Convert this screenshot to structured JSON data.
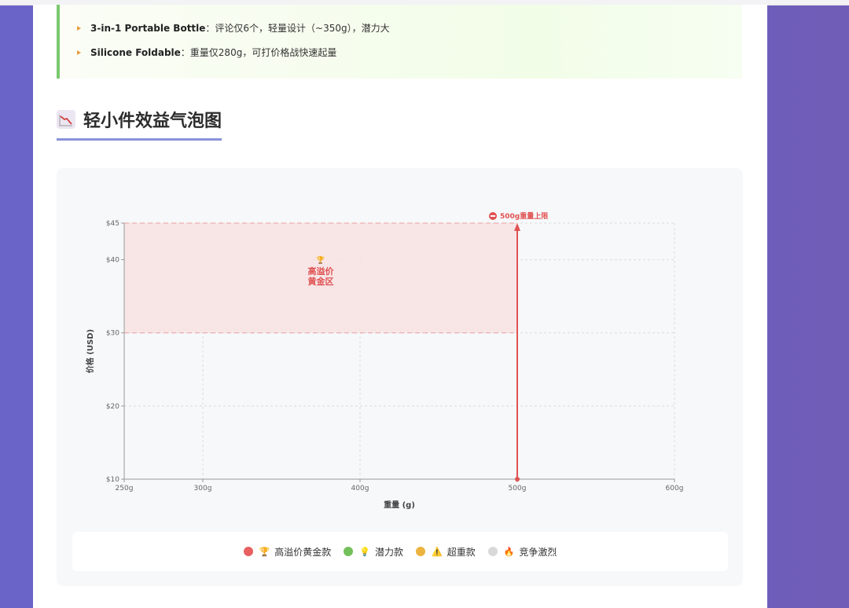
{
  "highlights": [
    {
      "name": "3-in-1 Portable Bottle",
      "desc": "：评论仅6个，轻量设计（~350g），潜力大"
    },
    {
      "name": "Silicone Foldable",
      "desc": "：重量仅280g，可打价格战快速起量"
    }
  ],
  "section": {
    "title": "轻小件效益气泡图",
    "icon": "chart-down-icon"
  },
  "colors": {
    "accent": "#e05252",
    "zone_fill": "#f8e3e3",
    "grid": "#dcdcdc",
    "title_underline": "#8a93d8",
    "highlight_border": "#7bc96f"
  },
  "chart_data": {
    "type": "scatter",
    "xlabel": "重量 (g)",
    "ylabel": "价格 (USD)",
    "xlim": [
      250,
      600
    ],
    "ylim": [
      10,
      45
    ],
    "x_ticks": [
      250,
      300,
      400,
      500,
      600
    ],
    "x_tick_labels": [
      "250g",
      "300g",
      "400g",
      "500g",
      "600g"
    ],
    "y_ticks": [
      10,
      20,
      30,
      40,
      45
    ],
    "y_tick_labels": [
      "$10",
      "$20",
      "$30",
      "$40",
      "$45"
    ],
    "grid": true,
    "zone": {
      "x": [
        250,
        500
      ],
      "y": [
        30,
        45
      ],
      "label_line1": "高溢价",
      "label_line2": "黄金区",
      "icon": "🏆"
    },
    "limit_line": {
      "x": 500,
      "label": "500g重量上限",
      "icon": "⛔"
    },
    "legend_position": "bottom",
    "legend": [
      {
        "label": "高溢价黄金款",
        "emoji": "🏆",
        "color": "#e86060"
      },
      {
        "label": "潜力款",
        "emoji": "💡",
        "color": "#73c05a"
      },
      {
        "label": "超重款",
        "emoji": "⚠️",
        "color": "#ecb33e"
      },
      {
        "label": "竞争激烈",
        "emoji": "🔥",
        "color": "#d9d9d9"
      }
    ],
    "points": []
  }
}
